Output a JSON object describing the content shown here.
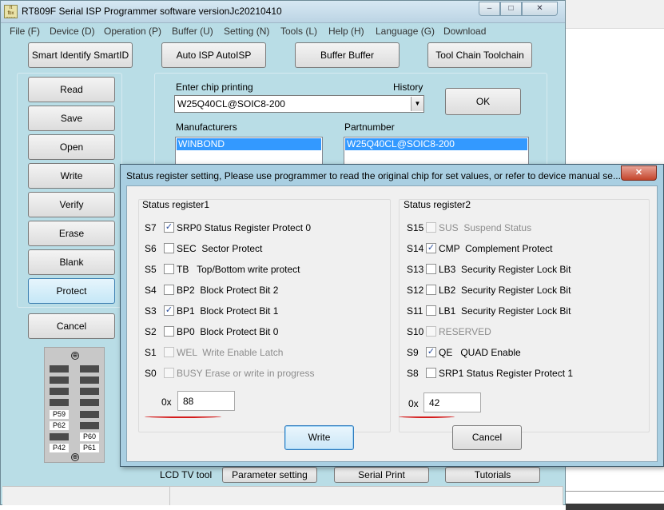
{
  "main_window": {
    "title": "RT809F Serial ISP Programmer software versionJc20210410",
    "logo_text": "rt\nfbx\nprog",
    "caption": {
      "minimize": "–",
      "maximize": "□",
      "close": "✕"
    }
  },
  "menu": [
    "File (F)",
    "Device (D)",
    "Operation (P)",
    "Buffer (U)",
    "Setting (N)",
    "Tools (L)",
    "Help (H)",
    "Language (G)",
    "Download"
  ],
  "top_buttons": [
    "Smart Identify SmartID",
    "Auto ISP AutoISP",
    "Buffer Buffer",
    "Tool Chain Toolchain"
  ],
  "side_buttons": [
    "Read",
    "Save",
    "Open",
    "Write",
    "Verify",
    "Erase",
    "Blank",
    "Protect"
  ],
  "cancel_label": "Cancel",
  "chip": {
    "enter_label": "Enter chip printing",
    "history_label": "History",
    "value": "W25Q40CL@SOIC8-200",
    "ok_label": "OK",
    "manufacturers_label": "Manufacturers",
    "partnumber_label": "Partnumber",
    "manufacturer_selected": "WINBOND",
    "partnumber_selected": "W25Q40CL@SOIC8-200"
  },
  "chip_diagram": {
    "pins_left": [
      "P59",
      "P62",
      "P42"
    ],
    "pins_right": [
      "P60",
      "P61"
    ],
    "screw_glyph": "⊕"
  },
  "bottom_tabs": {
    "lcd_label": "LCD TV tool",
    "items": [
      "Parameter setting",
      "Serial Print",
      "Tutorials"
    ]
  },
  "dialog": {
    "title": "Status register setting, Please use programmer to read the original chip for set values, or refer to device manual se...",
    "close": "✕",
    "hex_prefix": "0x",
    "write_label": "Write",
    "cancel_label": "Cancel",
    "register1": {
      "title": "Status register1",
      "bits": [
        {
          "code": "S7",
          "label": "SRP0 Status Register Protect 0",
          "checked": true,
          "enabled": true
        },
        {
          "code": "S6",
          "label": "SEC  Sector Protect",
          "checked": false,
          "enabled": true
        },
        {
          "code": "S5",
          "label": "TB   Top/Bottom write protect",
          "checked": false,
          "enabled": true
        },
        {
          "code": "S4",
          "label": "BP2  Block Protect Bit 2",
          "checked": false,
          "enabled": true
        },
        {
          "code": "S3",
          "label": "BP1  Block Protect Bit 1",
          "checked": true,
          "enabled": true
        },
        {
          "code": "S2",
          "label": "BP0  Block Protect Bit 0",
          "checked": false,
          "enabled": true
        },
        {
          "code": "S1",
          "label": "WEL  Write Enable Latch",
          "checked": false,
          "enabled": false
        },
        {
          "code": "S0",
          "label": "BUSY Erase or write in progress",
          "checked": false,
          "enabled": false
        }
      ],
      "hex_value": "88"
    },
    "register2": {
      "title": "Status register2",
      "bits": [
        {
          "code": "S15",
          "label": "SUS  Suspend Status",
          "checked": false,
          "enabled": false
        },
        {
          "code": "S14",
          "label": "CMP  Complement Protect",
          "checked": true,
          "enabled": true
        },
        {
          "code": "S13",
          "label": "LB3  Security Register Lock Bit",
          "checked": false,
          "enabled": true
        },
        {
          "code": "S12",
          "label": "LB2  Security Register Lock Bit",
          "checked": false,
          "enabled": true
        },
        {
          "code": "S11",
          "label": "LB1  Security Register Lock Bit",
          "checked": false,
          "enabled": true
        },
        {
          "code": "S10",
          "label": "RESERVED",
          "checked": false,
          "enabled": false
        },
        {
          "code": "S9",
          "label": "QE   QUAD Enable",
          "checked": true,
          "enabled": true
        },
        {
          "code": "S8",
          "label": "SRP1 Status Register Protect 1",
          "checked": false,
          "enabled": true
        }
      ],
      "hex_value": "42"
    }
  }
}
